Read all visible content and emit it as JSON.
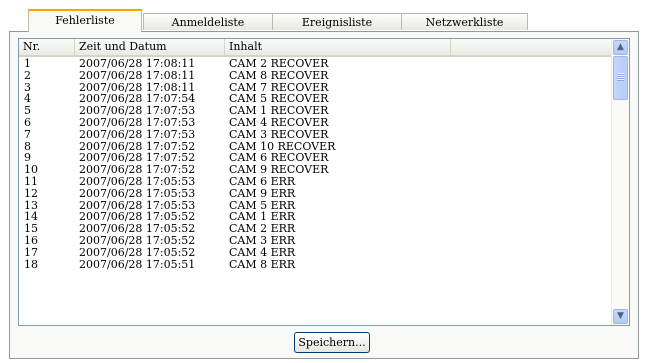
{
  "tabs": [
    {
      "label": "Fehlerliste",
      "active": true
    },
    {
      "label": "Anmeldeliste",
      "active": false
    },
    {
      "label": "Ereignisliste",
      "active": false
    },
    {
      "label": "Netzwerkliste",
      "active": false
    }
  ],
  "table": {
    "headers": [
      "Nr.",
      "Zeit und Datum",
      "Inhalt"
    ],
    "rows": [
      [
        "1",
        "2007/06/28 17:08:11",
        "CAM 2 RECOVER"
      ],
      [
        "2",
        "2007/06/28 17:08:11",
        "CAM 8 RECOVER"
      ],
      [
        "3",
        "2007/06/28 17:08:11",
        "CAM 7 RECOVER"
      ],
      [
        "4",
        "2007/06/28 17:07:54",
        "CAM 5 RECOVER"
      ],
      [
        "5",
        "2007/06/28 17:07:53",
        "CAM 1 RECOVER"
      ],
      [
        "6",
        "2007/06/28 17:07:53",
        "CAM 4 RECOVER"
      ],
      [
        "7",
        "2007/06/28 17:07:53",
        "CAM 3 RECOVER"
      ],
      [
        "8",
        "2007/06/28 17:07:52",
        "CAM 10 RECOVER"
      ],
      [
        "9",
        "2007/06/28 17:07:52",
        "CAM 6 RECOVER"
      ],
      [
        "10",
        "2007/06/28 17:07:52",
        "CAM 9 RECOVER"
      ],
      [
        "11",
        "2007/06/28 17:05:53",
        "CAM 6 ERR"
      ],
      [
        "12",
        "2007/06/28 17:05:53",
        "CAM 9 ERR"
      ],
      [
        "13",
        "2007/06/28 17:05:53",
        "CAM 5 ERR"
      ],
      [
        "14",
        "2007/06/28 17:05:52",
        "CAM 1 ERR"
      ],
      [
        "15",
        "2007/06/28 17:05:52",
        "CAM 2 ERR"
      ],
      [
        "16",
        "2007/06/28 17:05:52",
        "CAM 3 ERR"
      ],
      [
        "17",
        "2007/06/28 17:05:52",
        "CAM 4 ERR"
      ],
      [
        "18",
        "2007/06/28 17:05:51",
        "CAM 8 ERR"
      ]
    ]
  },
  "icons": {
    "scroll_up": "chevron-up-icon",
    "scroll_down": "chevron-down-icon"
  },
  "save_button": {
    "label": "Speichern..."
  },
  "colors": {
    "active_tab_accent": "#ffa200",
    "scrollbar": "#c1d3fb",
    "list_border": "#7f9db9"
  }
}
